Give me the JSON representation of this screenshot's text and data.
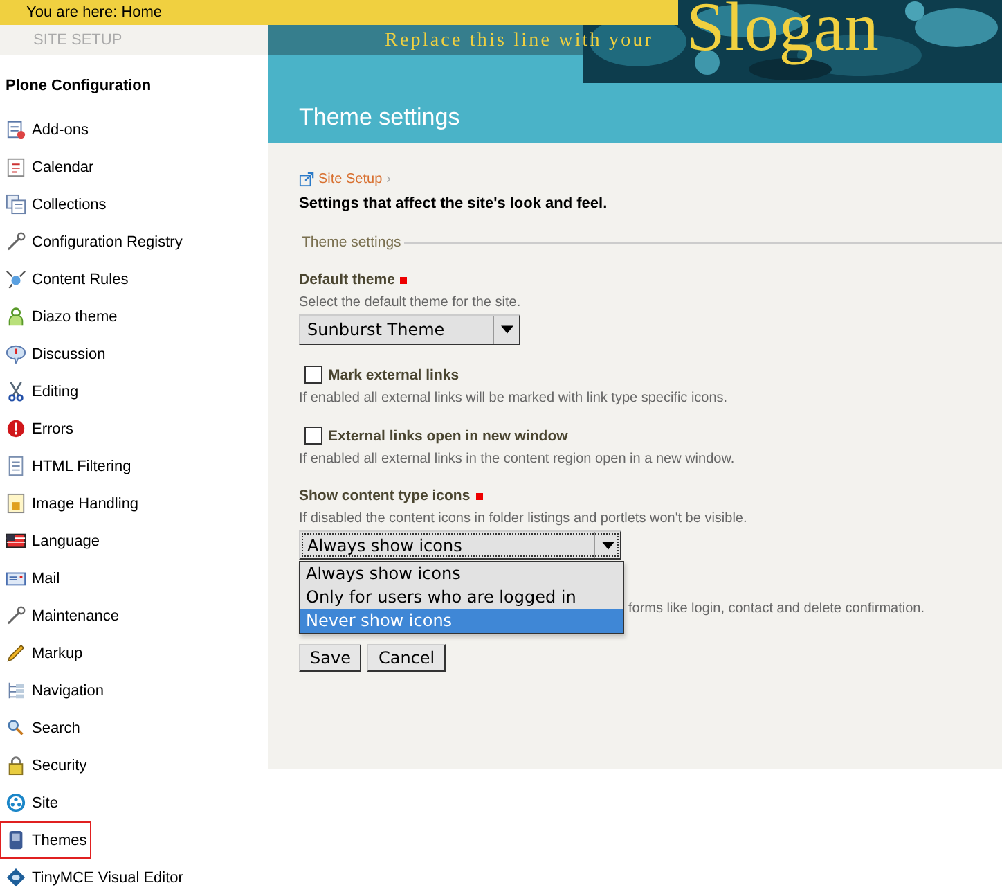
{
  "header": {
    "breadcrumb": "You are here: Home",
    "tagline": "Replace this line with your",
    "slogan": "Slogan",
    "site_setup_tab": "SITE SETUP"
  },
  "sidebar": {
    "heading": "Plone Configuration",
    "items": [
      {
        "label": "Add-ons",
        "selected": false
      },
      {
        "label": "Calendar",
        "selected": false
      },
      {
        "label": "Collections",
        "selected": false
      },
      {
        "label": "Configuration Registry",
        "selected": false
      },
      {
        "label": "Content Rules",
        "selected": false
      },
      {
        "label": "Diazo theme",
        "selected": false
      },
      {
        "label": "Discussion",
        "selected": false
      },
      {
        "label": "Editing",
        "selected": false
      },
      {
        "label": "Errors",
        "selected": false
      },
      {
        "label": "HTML Filtering",
        "selected": false
      },
      {
        "label": "Image Handling",
        "selected": false
      },
      {
        "label": "Language",
        "selected": false
      },
      {
        "label": "Mail",
        "selected": false
      },
      {
        "label": "Maintenance",
        "selected": false
      },
      {
        "label": "Markup",
        "selected": false
      },
      {
        "label": "Navigation",
        "selected": false
      },
      {
        "label": "Search",
        "selected": false
      },
      {
        "label": "Security",
        "selected": false
      },
      {
        "label": "Site",
        "selected": false
      },
      {
        "label": "Themes",
        "selected": true
      },
      {
        "label": "TinyMCE Visual Editor",
        "selected": false
      }
    ]
  },
  "main": {
    "title": "Theme settings",
    "breadcrumb": "Site Setup",
    "breadcrumb_separator": "›",
    "intro": "Settings that affect the site's look and feel.",
    "legend": "Theme settings",
    "fields": [
      {
        "kind": "select",
        "label": "Default theme",
        "required": true,
        "description": "Select the default theme for the site.",
        "value": "Sunburst Theme"
      },
      {
        "kind": "checkbox",
        "label": "Mark external links",
        "checked": false,
        "description": "If enabled all external links will be marked with link type specific icons."
      },
      {
        "kind": "checkbox",
        "label": "External links open in new window",
        "checked": false,
        "description": "If enabled all external links in the content region open in a new window."
      },
      {
        "kind": "open-select",
        "label": "Show content type icons",
        "required": true,
        "description": "If disabled the content icons in folder listings and portlets won't be visible.",
        "value": "Always show icons",
        "options": [
          {
            "label": "Always show icons",
            "highlighted": false
          },
          {
            "label": "Only for users who are logged in",
            "highlighted": false
          },
          {
            "label": "Never show icons",
            "highlighted": true
          }
        ]
      },
      {
        "kind": "description-only",
        "description": "forms like login, contact and delete confirmation."
      }
    ],
    "buttons": [
      "Save",
      "Cancel"
    ]
  }
}
